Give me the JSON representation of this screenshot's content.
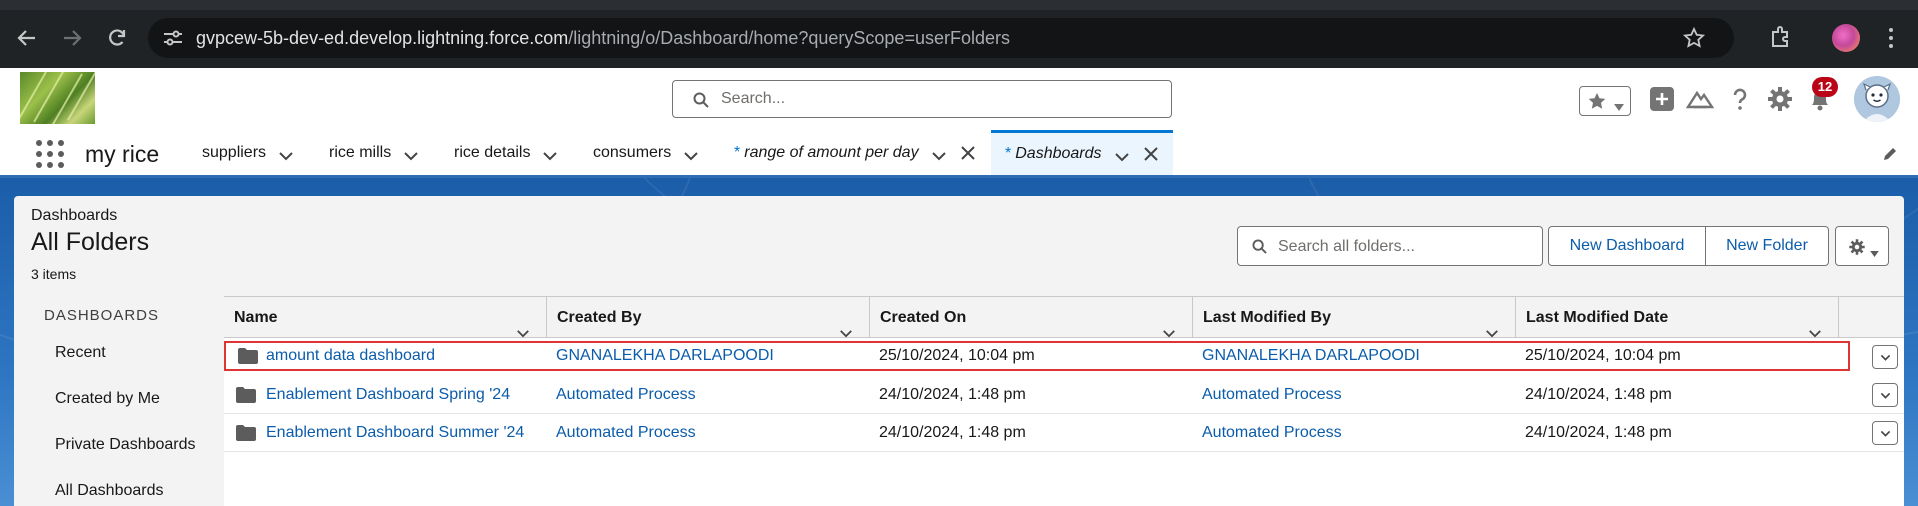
{
  "browser": {
    "url_host": "gvpcew-5b-dev-ed.develop.lightning.force.com",
    "url_path": "/lightning/o/Dashboard/home?queryScope=userFolders"
  },
  "header": {
    "search_placeholder": "Search...",
    "notification_count": "12"
  },
  "app_nav": {
    "app_name": "my rice",
    "items": [
      {
        "label": "suppliers"
      },
      {
        "label": "rice mills"
      },
      {
        "label": "rice details"
      },
      {
        "label": "consumers"
      },
      {
        "label": "range of amount per day",
        "unsaved_marker": "*"
      },
      {
        "label": "Dashboards",
        "unsaved_marker": "*"
      }
    ]
  },
  "page": {
    "breadcrumb": "Dashboards",
    "title": "All Folders",
    "item_count": "3 items",
    "folder_search_placeholder": "Search all folders...",
    "new_dashboard_label": "New Dashboard",
    "new_folder_label": "New Folder"
  },
  "sidebar": {
    "heading": "DASHBOARDS",
    "items": [
      "Recent",
      "Created by Me",
      "Private Dashboards",
      "All Dashboards"
    ]
  },
  "table": {
    "columns": [
      "Name",
      "Created By",
      "Created On",
      "Last Modified By",
      "Last Modified Date"
    ],
    "rows": [
      {
        "name": "amount data dashboard",
        "created_by": "GNANALEKHA DARLAPOODI",
        "created_on": "25/10/2024, 10:04 pm",
        "last_modified_by": "GNANALEKHA DARLAPOODI",
        "last_modified_date": "25/10/2024, 10:04 pm"
      },
      {
        "name": "Enablement Dashboard Spring '24",
        "created_by": "Automated Process",
        "created_on": "24/10/2024, 1:48 pm",
        "last_modified_by": "Automated Process",
        "last_modified_date": "24/10/2024, 1:48 pm"
      },
      {
        "name": "Enablement Dashboard Summer '24",
        "created_by": "Automated Process",
        "created_on": "24/10/2024, 1:48 pm",
        "last_modified_by": "Automated Process",
        "last_modified_date": "24/10/2024, 1:48 pm"
      }
    ]
  },
  "colors": {
    "brand_blue": "#0176d3",
    "link_blue": "#0b5cab",
    "highlight_border": "#e03434",
    "badge_red": "#ba0517"
  },
  "icons": [
    "back-arrow-icon",
    "forward-arrow-icon",
    "reload-icon",
    "site-settings-icon",
    "bookmark-star-icon",
    "extensions-icon",
    "profile-icon",
    "chrome-menu-icon",
    "search-icon",
    "favorites-star-icon",
    "add-icon",
    "trailhead-icon",
    "help-icon",
    "setup-gear-icon",
    "bell-icon",
    "app-launcher-icon",
    "chevron-down-icon",
    "close-icon",
    "edit-pencil-icon",
    "folder-icon",
    "settings-gear-icon"
  ]
}
